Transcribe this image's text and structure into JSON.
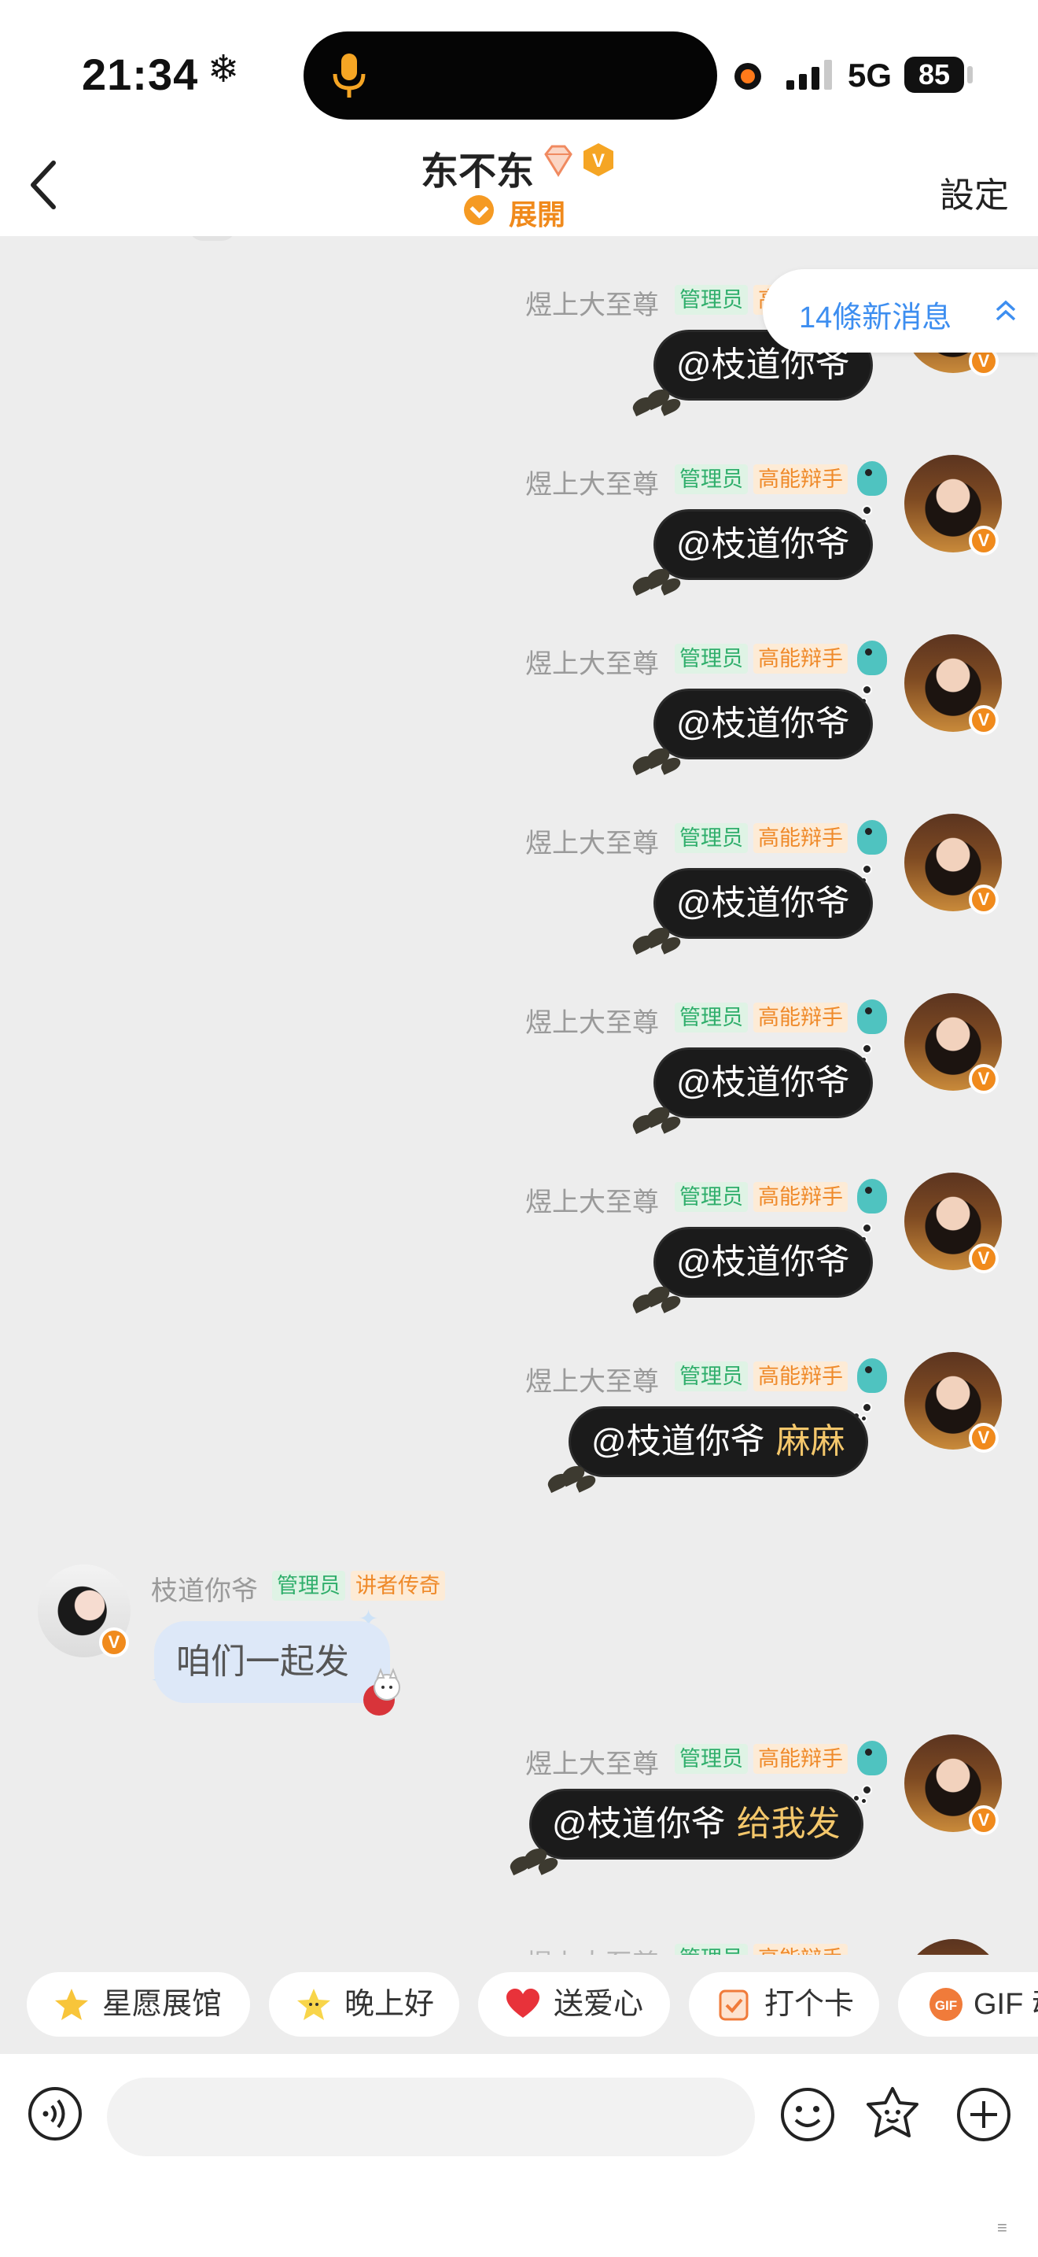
{
  "status_bar": {
    "time": "21:34",
    "weather_icon": "snowflake-icon",
    "network": "5G",
    "battery": "85"
  },
  "header": {
    "back_icon": "back-chevron-icon",
    "title": "东不东",
    "expand_label": "展開",
    "settings_label": "設定"
  },
  "new_messages": {
    "label": "14條新消息",
    "icon": "double-chevron-up-icon"
  },
  "tags": {
    "admin": "管理员",
    "debater": "高能辩手",
    "legend": "讲者传奇"
  },
  "messages": [
    {
      "sender": "煜上大至尊",
      "text": "@枝道你爷",
      "extra": ""
    },
    {
      "sender": "煜上大至尊",
      "text": "@枝道你爷",
      "extra": ""
    },
    {
      "sender": "煜上大至尊",
      "text": "@枝道你爷",
      "extra": ""
    },
    {
      "sender": "煜上大至尊",
      "text": "@枝道你爷",
      "extra": ""
    },
    {
      "sender": "煜上大至尊",
      "text": "@枝道你爷",
      "extra": ""
    },
    {
      "sender": "煜上大至尊",
      "text": "@枝道你爷",
      "extra": ""
    },
    {
      "sender": "煜上大至尊",
      "text": "@枝道你爷",
      "extra": "麻麻"
    },
    {
      "sender": "枝道你爷",
      "text": "咱们一起发",
      "extra": ""
    },
    {
      "sender": "煜上大至尊",
      "text": "@枝道你爷",
      "extra": "给我发"
    }
  ],
  "quick_chips": [
    {
      "label": "星愿展馆",
      "icon": "star-icon"
    },
    {
      "label": "晚上好",
      "icon": "smiling-star-icon"
    },
    {
      "label": "送爱心",
      "icon": "heart-icon"
    },
    {
      "label": "打个卡",
      "icon": "checkin-icon"
    },
    {
      "label": "GIF 动",
      "icon": "gif-icon"
    }
  ],
  "input": {
    "placeholder": ""
  },
  "colors": {
    "accent_orange": "#f08a1c",
    "admin_green": "#2fae6b",
    "debater_orange": "#ef8a2a",
    "link_blue": "#3d8ef0",
    "chat_bg": "#ededed",
    "bubble_dark": "#1b1b1b",
    "highlight_gold": "#f4c76b"
  }
}
